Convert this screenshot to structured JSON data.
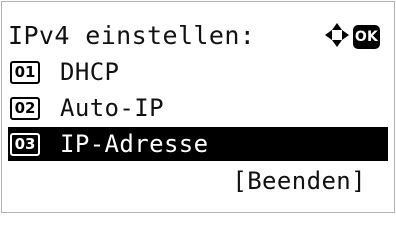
{
  "title": "IPv4 einstellen:",
  "nav_icon": "four-way-arrow-icon",
  "ok_key": "OK",
  "menu": {
    "items": [
      {
        "number": "01",
        "label": "DHCP",
        "selected": false
      },
      {
        "number": "02",
        "label": "Auto-IP",
        "selected": false
      },
      {
        "number": "03",
        "label": "IP-Adresse",
        "selected": true
      }
    ]
  },
  "footer": {
    "end_label": "[Beenden]"
  },
  "colors": {
    "foreground": "#111111",
    "selected_background": "#000000",
    "selected_foreground": "#ffffff",
    "frame": "#b4b4b4"
  }
}
